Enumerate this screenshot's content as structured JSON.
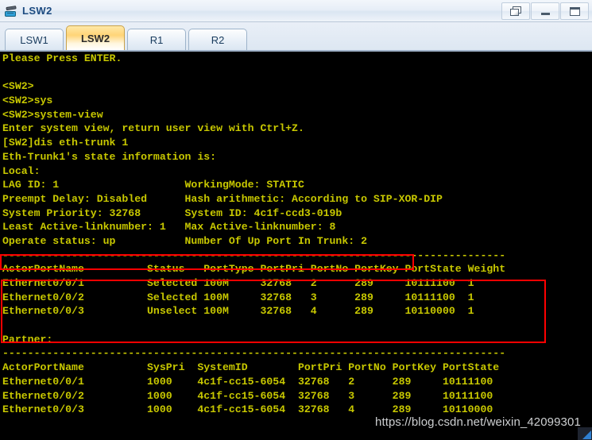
{
  "window": {
    "title": "LSW2",
    "icon": "switch-icon",
    "buttons": [
      {
        "name": "restore-button",
        "glyph": "restore-icon",
        "label": "Restore"
      },
      {
        "name": "minimize-button",
        "glyph": "minimize-icon",
        "label": "Minimize"
      },
      {
        "name": "maximize-button",
        "glyph": "maximize-icon",
        "label": "Maximize"
      }
    ]
  },
  "tabs": [
    {
      "label": "LSW1",
      "active": false
    },
    {
      "label": "LSW2",
      "active": true
    },
    {
      "label": "R1",
      "active": false
    },
    {
      "label": "R2",
      "active": false
    }
  ],
  "colors": {
    "terminal_background": "#000000",
    "terminal_text": "#c8c800",
    "highlight_box": "#ff0000",
    "active_tab": "#ffd477",
    "title_text": "#1b4a80"
  },
  "terminal": {
    "lines": [
      "Please Press ENTER.",
      "",
      "<SW2>",
      "<SW2>sys",
      "<SW2>system-view",
      "Enter system view, return user view with Ctrl+Z.",
      "[SW2]dis eth-trunk 1",
      "Eth-Trunk1's state information is:",
      "Local:",
      "LAG ID: 1                    WorkingMode: STATIC",
      "Preempt Delay: Disabled      Hash arithmetic: According to SIP-XOR-DIP",
      "System Priority: 32768       System ID: 4c1f-ccd3-019b",
      "Least Active-linknumber: 1   Max Active-linknumber: 8",
      "Operate status: up           Number Of Up Port In Trunk: 2",
      "--------------------------------------------------------------------------------",
      "ActorPortName          Status   PortType PortPri PortNo PortKey PortState Weight",
      "Ethernet0/0/1          Selected 100M     32768   2      289     10111100  1",
      "Ethernet0/0/2          Selected 100M     32768   3      289     10111100  1",
      "Ethernet0/0/3          Unselect 100M     32768   4      289     10110000  1",
      "",
      "Partner:",
      "--------------------------------------------------------------------------------",
      "ActorPortName          SysPri  SystemID        PortPri PortNo PortKey PortState",
      "Ethernet0/0/1          1000    4c1f-cc15-6054  32768   2      289     10111100",
      "Ethernet0/0/2          1000    4c1f-cc15-6054  32768   3      289     10111100",
      "Ethernet0/0/3          1000    4c1f-cc15-6054  32768   4      289     10110000"
    ],
    "highlight_boxes": [
      {
        "name": "operate-status-highlight",
        "target_line": "Operate status: up           Number Of Up Port In Trunk: 2"
      },
      {
        "name": "local-port-table-highlight",
        "target_line": "ActorPortName          Status   PortType PortPri PortNo PortKey PortState Weight"
      }
    ]
  },
  "local_table": {
    "headers": [
      "ActorPortName",
      "Status",
      "PortType",
      "PortPri",
      "PortNo",
      "PortKey",
      "PortState",
      "Weight"
    ],
    "rows": [
      [
        "Ethernet0/0/1",
        "Selected",
        "100M",
        "32768",
        "2",
        "289",
        "10111100",
        "1"
      ],
      [
        "Ethernet0/0/2",
        "Selected",
        "100M",
        "32768",
        "3",
        "289",
        "10111100",
        "1"
      ],
      [
        "Ethernet0/0/3",
        "Unselect",
        "100M",
        "32768",
        "4",
        "289",
        "10110000",
        "1"
      ]
    ]
  },
  "partner_table": {
    "headers": [
      "ActorPortName",
      "SysPri",
      "SystemID",
      "PortPri",
      "PortNo",
      "PortKey",
      "PortState"
    ],
    "rows": [
      [
        "Ethernet0/0/1",
        "1000",
        "4c1f-cc15-6054",
        "32768",
        "2",
        "289",
        "10111100"
      ],
      [
        "Ethernet0/0/2",
        "1000",
        "4c1f-cc15-6054",
        "32768",
        "3",
        "289",
        "10111100"
      ],
      [
        "Ethernet0/0/3",
        "1000",
        "4c1f-cc15-6054",
        "32768",
        "4",
        "289",
        "10110000"
      ]
    ]
  },
  "trunk_info": {
    "lag_id": "1",
    "working_mode": "STATIC",
    "preempt_delay": "Disabled",
    "hash_arithmetic": "According to SIP-XOR-DIP",
    "system_priority": "32768",
    "system_id": "4c1f-ccd3-019b",
    "least_active_linknumber": "1",
    "max_active_linknumber": "8",
    "operate_status": "up",
    "number_of_up_port_in_trunk": "2"
  },
  "watermark": {
    "text": "https://blog.csdn.net/weixin_42099301"
  }
}
